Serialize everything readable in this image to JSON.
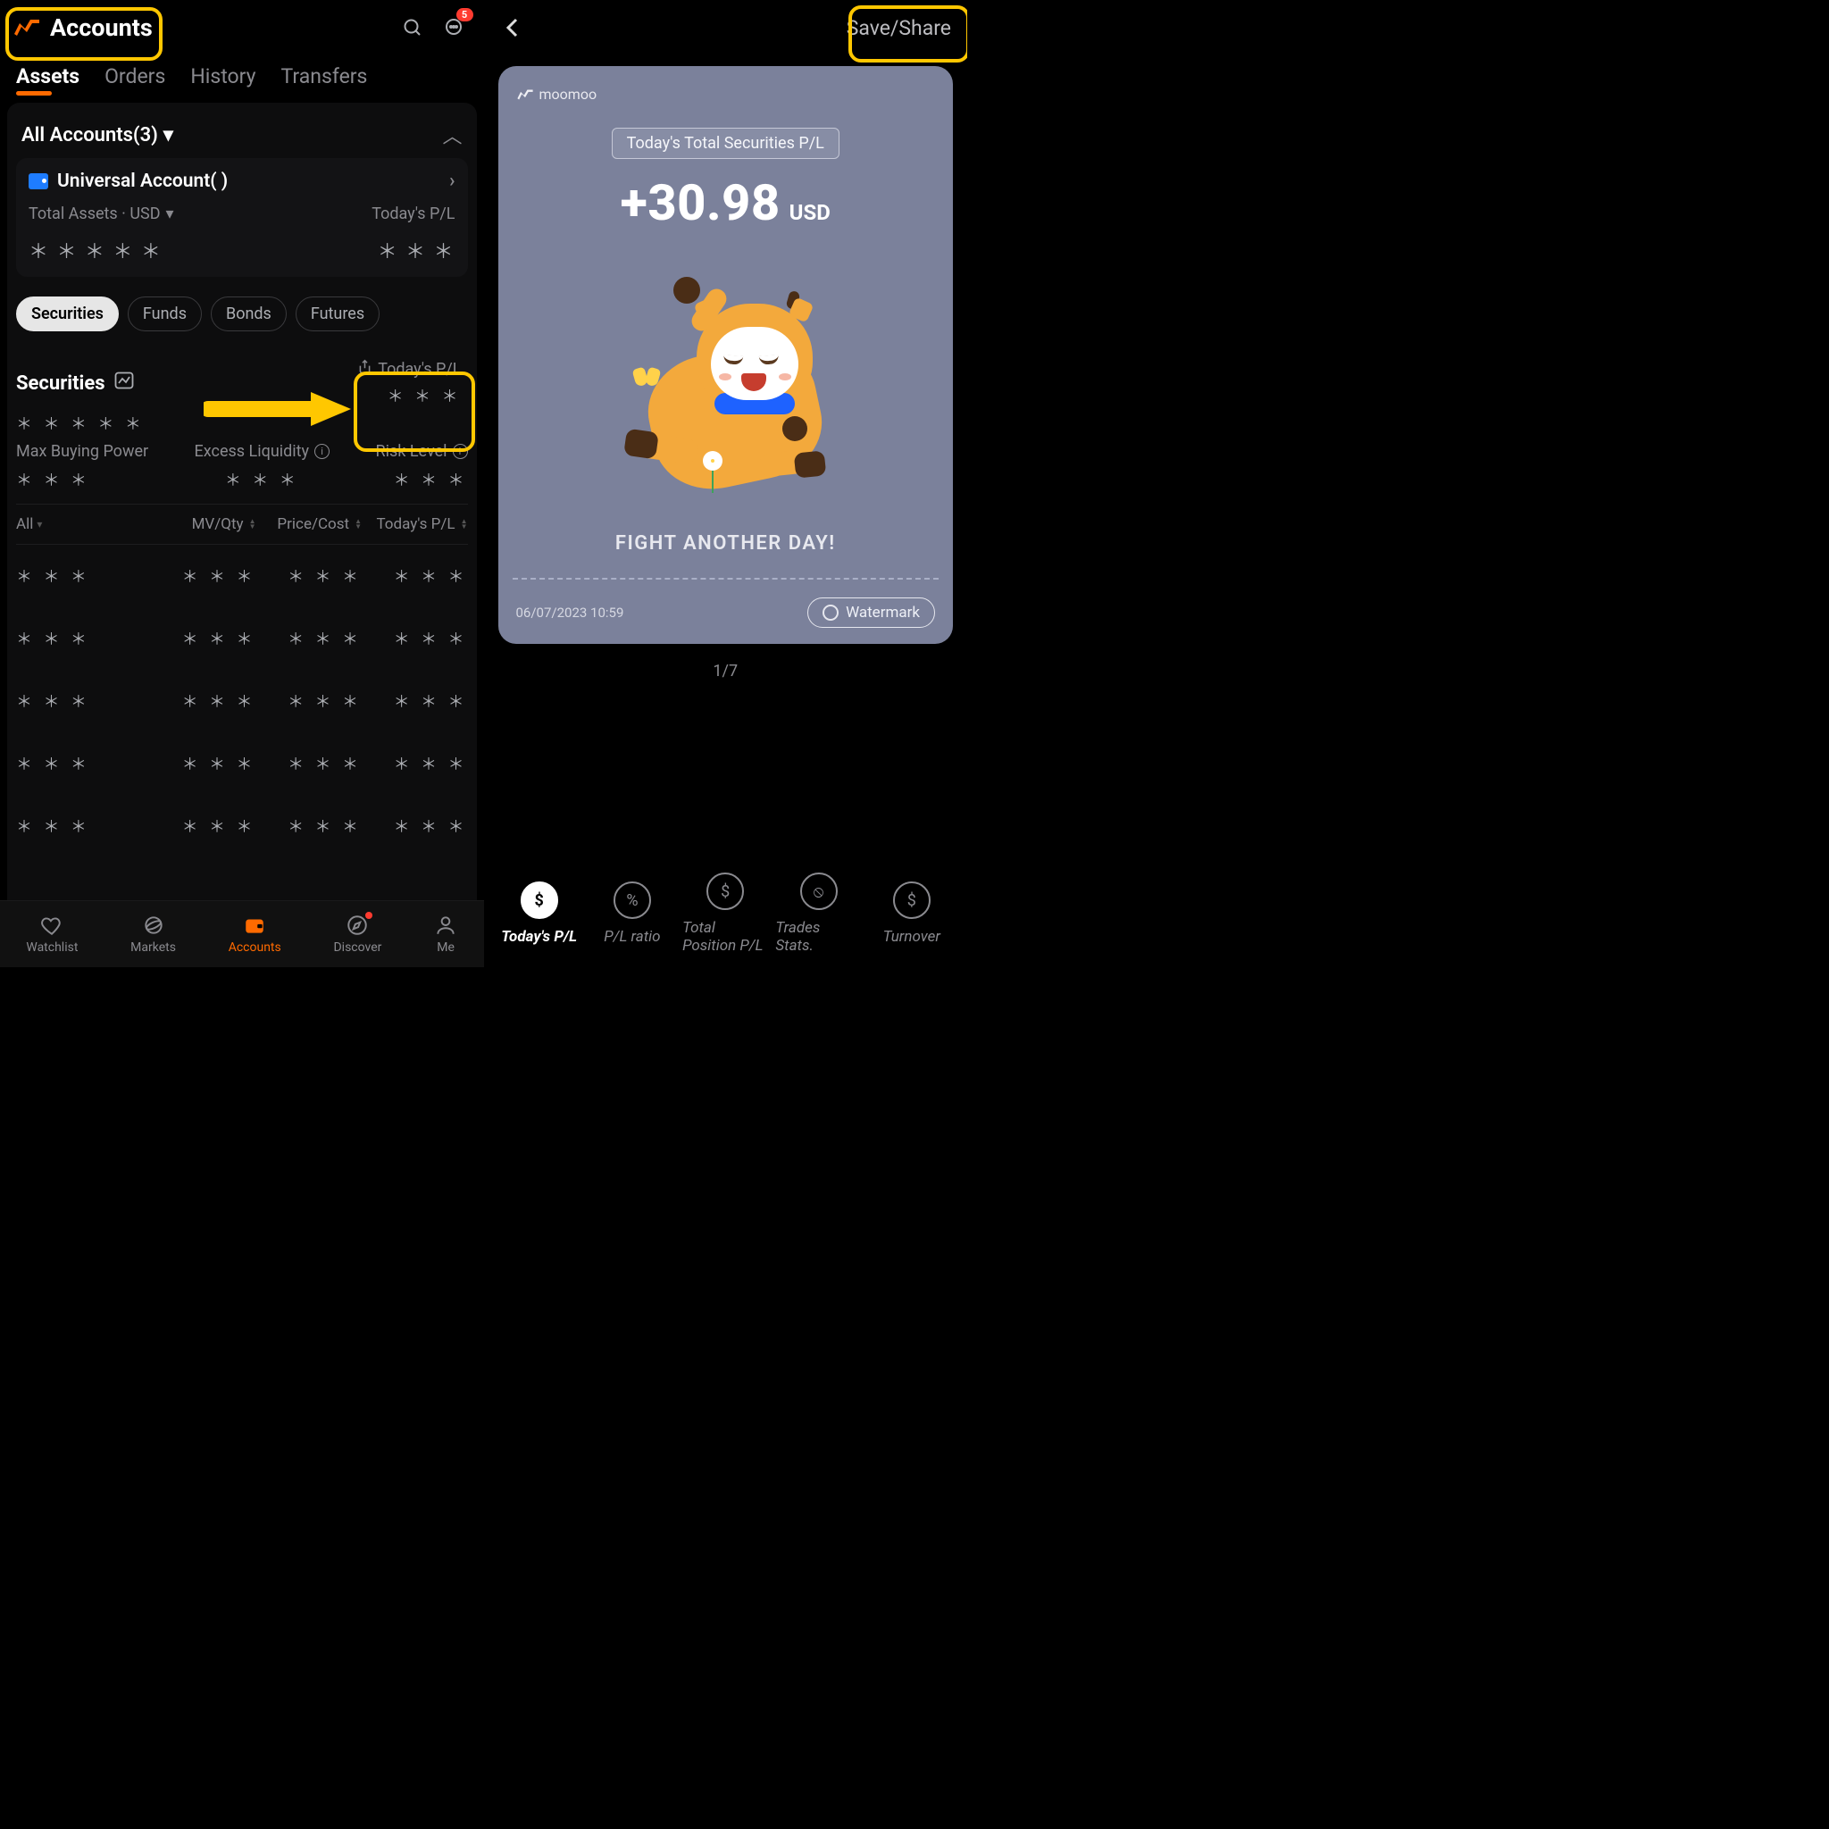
{
  "header": {
    "title": "Accounts",
    "notification_count": "5"
  },
  "tabs": {
    "assets": "Assets",
    "orders": "Orders",
    "history": "History",
    "transfers": "Transfers"
  },
  "accounts_header": "All Accounts(3)",
  "account": {
    "name": "Universal Account(        )",
    "total_assets_label": "Total Assets · USD",
    "todays_pl_label": "Today's P/L",
    "assets_masked": "＊ ＊ ＊ ＊ ＊",
    "pl_masked": "＊ ＊ ＊"
  },
  "chips": {
    "securities": "Securities",
    "funds": "Funds",
    "bonds": "Bonds",
    "futures": "Futures"
  },
  "securities": {
    "label": "Securities",
    "todays_pl": "Today's P/L",
    "assets_masked": "＊ ＊ ＊ ＊ ＊",
    "pl_masked": "＊ ＊ ＊"
  },
  "metrics": {
    "buying_power": "Max Buying Power",
    "excess_liquidity": "Excess Liquidity",
    "risk_level": "Risk Level",
    "masked": "＊ ＊ ＊"
  },
  "table": {
    "all": "All",
    "mvqty": "MV/Qty",
    "pricecost": "Price/Cost",
    "todayspl": "Today's P/L",
    "cell": "＊ ＊ ＊"
  },
  "nav": {
    "watchlist": "Watchlist",
    "markets": "Markets",
    "accounts": "Accounts",
    "discover": "Discover",
    "me": "Me"
  },
  "share": {
    "save_share": "Save/Share",
    "brand": "moomoo",
    "banner": "Today's Total Securities P/L",
    "amount": "+30.98",
    "currency": "USD",
    "tagline": "FIGHT ANOTHER DAY!",
    "timestamp": "06/07/2023 10:59",
    "watermark": "Watermark",
    "pager": "1/7"
  },
  "btabs": {
    "todays_pl": "Today's P/L",
    "pl_ratio": "P/L ratio",
    "total_position": "Total Position P/L",
    "trades_stats": "Trades Stats.",
    "turnover": "Turnover"
  }
}
